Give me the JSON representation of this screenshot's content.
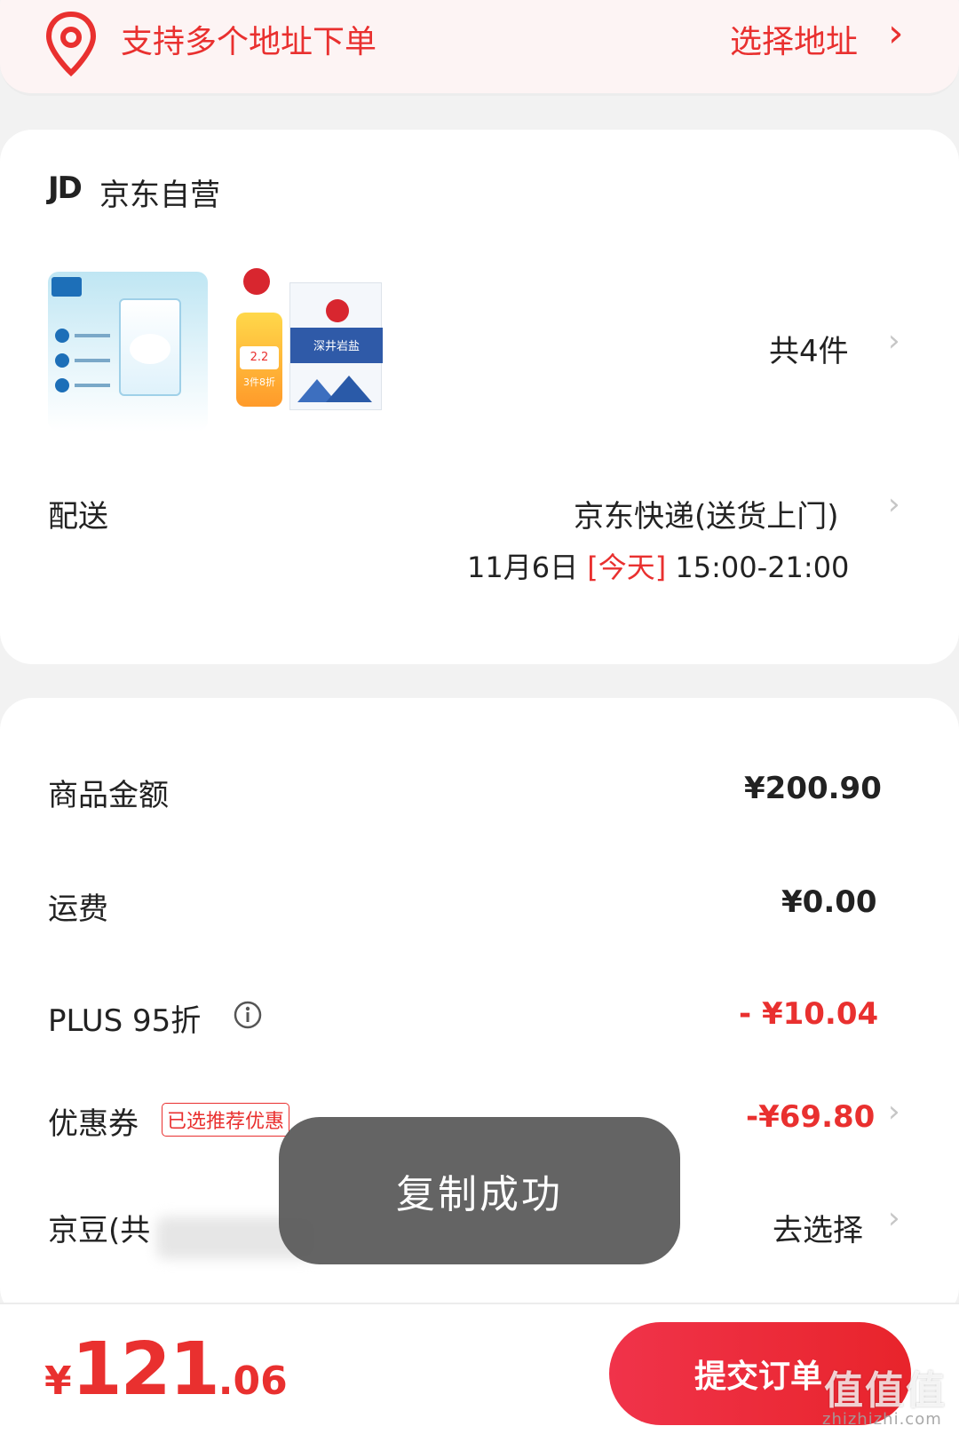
{
  "address": {
    "text": "支持多个地址下单",
    "action": "选择地址",
    "chevron": "›"
  },
  "shop": {
    "logo": "JD",
    "name": "京东自营"
  },
  "products": {
    "count": "共4件",
    "chevron": "›",
    "images": [
      {
        "name": "milk-carton-image"
      },
      {
        "name": "salt-bag-image",
        "badge_price": "2.2",
        "badge_discount": "3件8折",
        "pack_text": "深井岩盐"
      }
    ]
  },
  "delivery": {
    "label": "配送",
    "method": "京东快递(送货上门)",
    "date": "11月6日",
    "today": "[今天]",
    "time": "15:00-21:00",
    "chevron": "›"
  },
  "summary": {
    "goods": {
      "label": "商品金额",
      "value": "¥200.90"
    },
    "shipping": {
      "label": "运费",
      "value": "¥0.00"
    },
    "plus": {
      "label": "PLUS 95折",
      "value": "- ¥10.04",
      "info_icon": "info-icon"
    },
    "coupon": {
      "label": "优惠券",
      "tag": "已选推荐优惠",
      "value": "-¥69.80",
      "chevron": "›"
    },
    "beans": {
      "label": "京豆(共",
      "value": "去选择",
      "chevron": "›"
    }
  },
  "toast": "复制成功",
  "footer": {
    "currency": "¥",
    "total_int": "121",
    "total_dec": ".06",
    "submit": "提交订单"
  },
  "watermark": {
    "text": "值值值",
    "sub": "zhizhizhi.com"
  },
  "colors": {
    "accent": "#e9302f",
    "background": "#f2f2f2",
    "toast": "#5a5a5a"
  }
}
